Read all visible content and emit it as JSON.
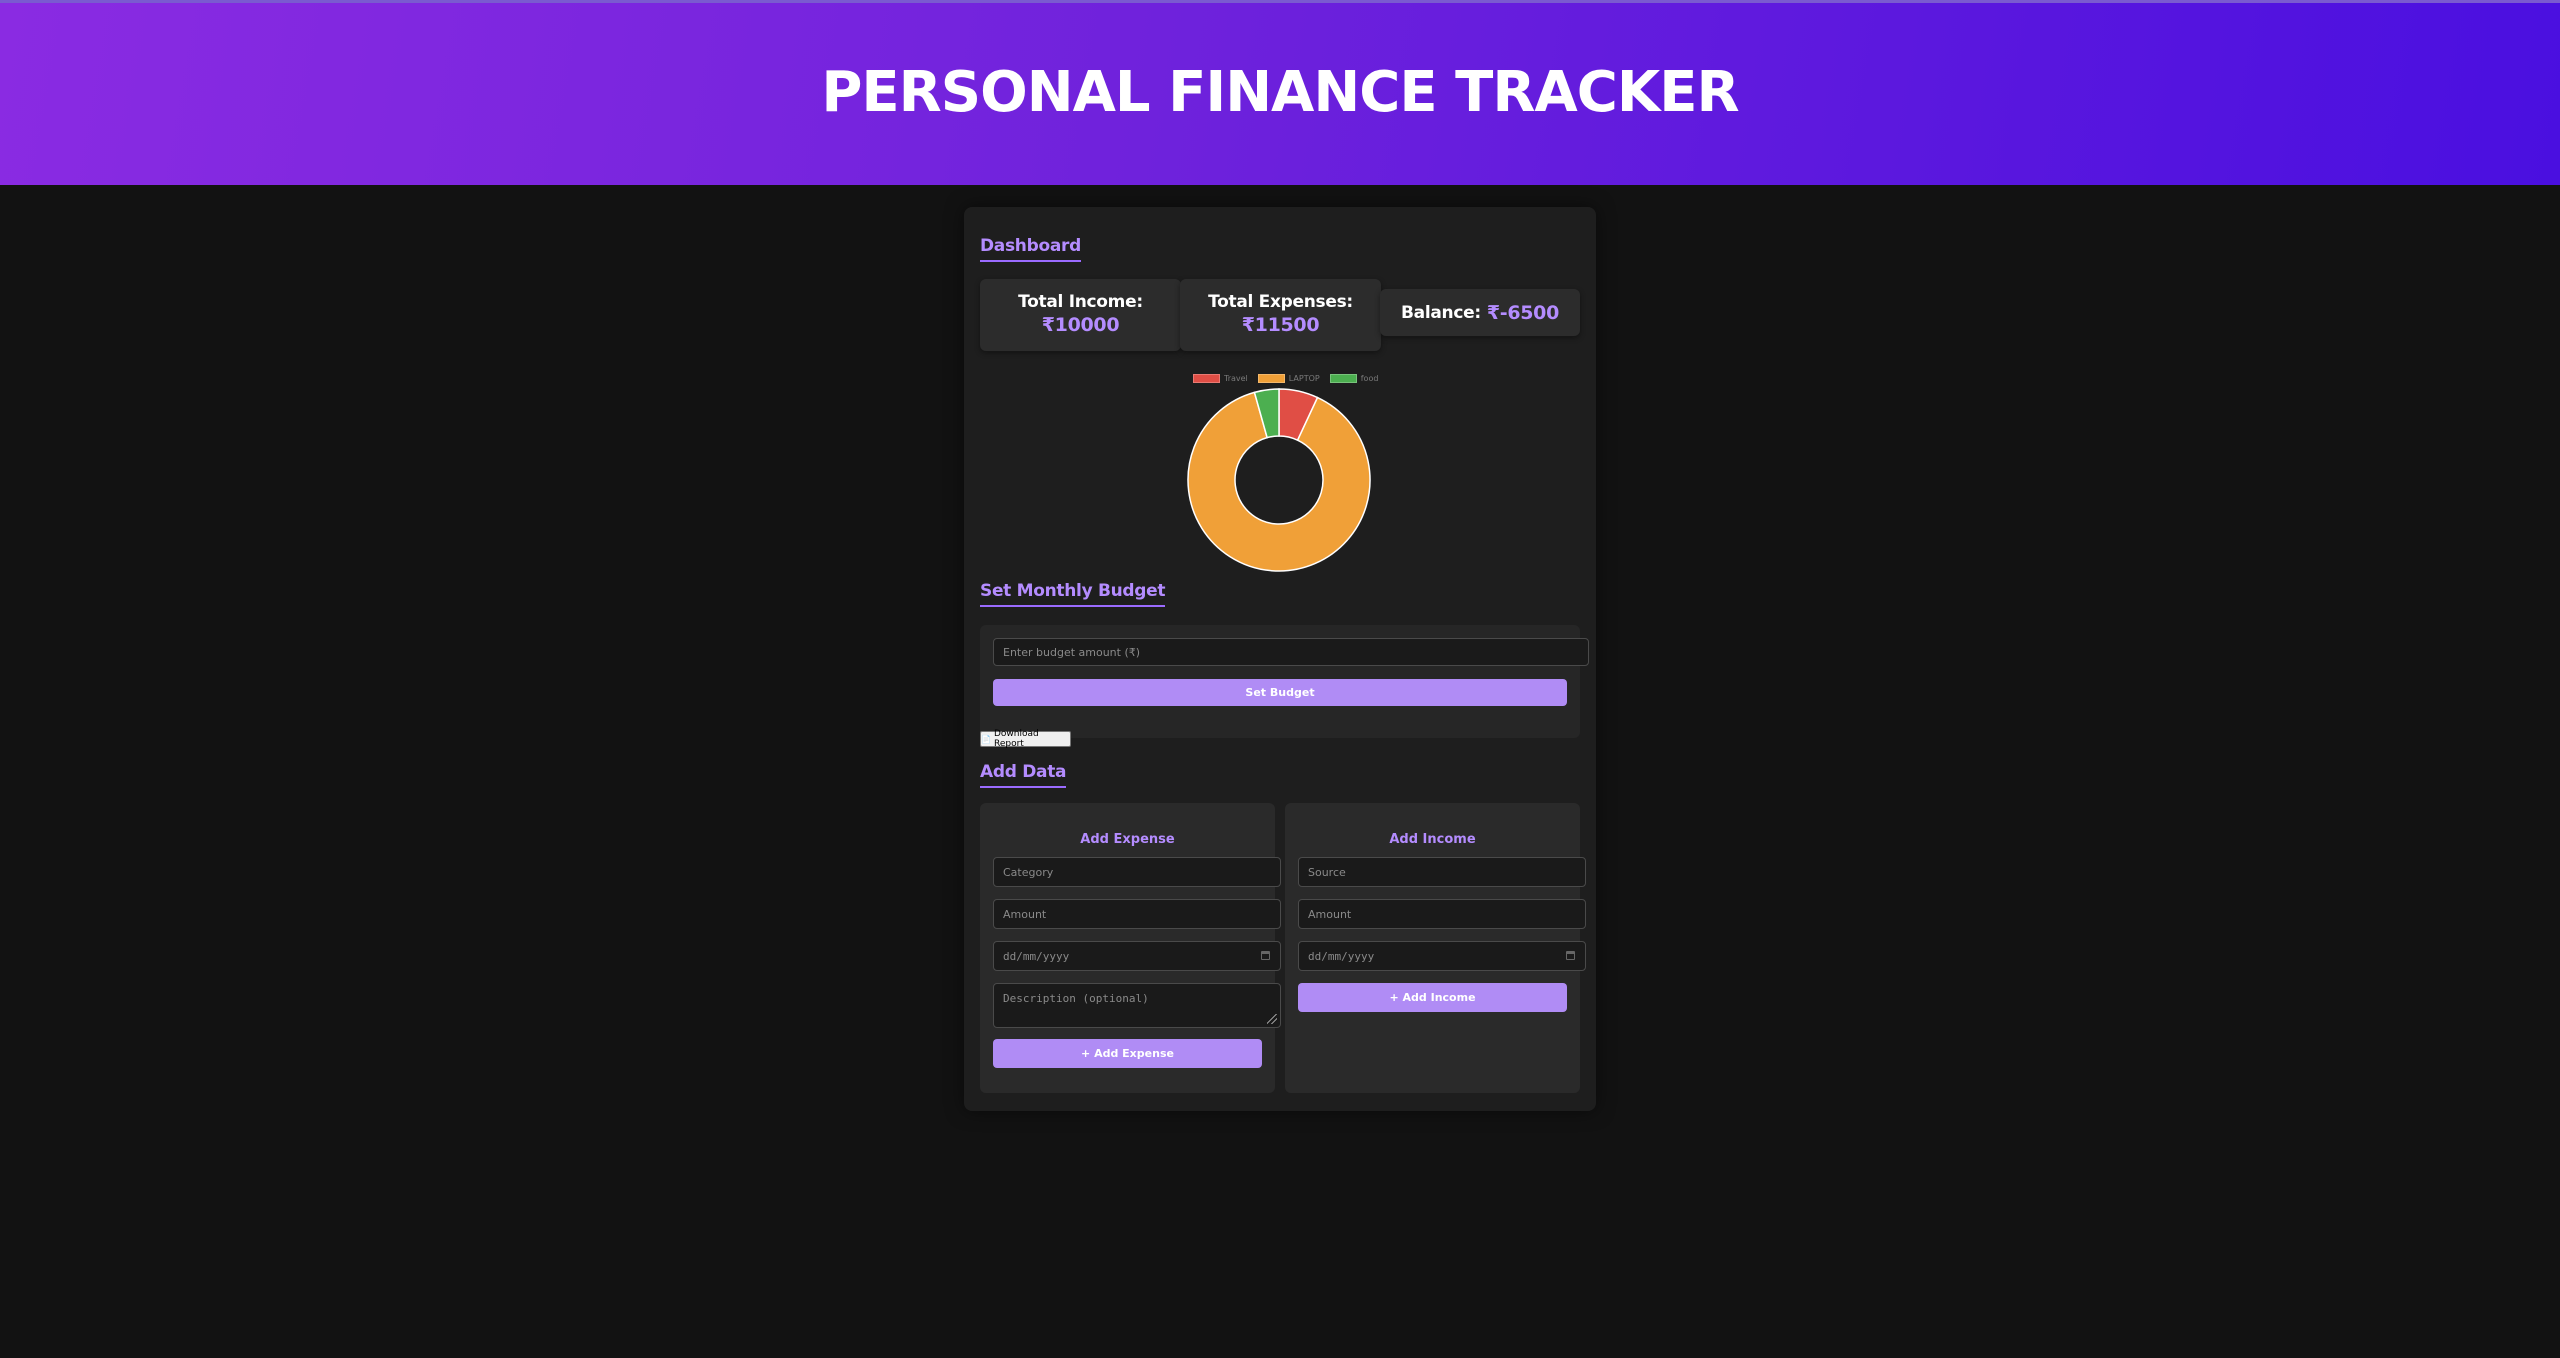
{
  "header": {
    "title": "PERSONAL FINANCE TRACKER"
  },
  "dashboard": {
    "title": "Dashboard",
    "income_label": "Total Income:",
    "income_value": "₹10000",
    "expenses_label": "Total Expenses:",
    "expenses_value": "₹11500",
    "balance_label": "Balance:",
    "balance_value": "₹-6500"
  },
  "chart_data": {
    "type": "pie",
    "labels": [
      "Travel",
      "LAPTOP",
      "food"
    ],
    "values": [
      800,
      10200,
      500
    ],
    "colors": [
      "#e04e45",
      "#f0a038",
      "#4caf50"
    ],
    "legend_position": "top"
  },
  "budget": {
    "title": "Set Monthly Budget",
    "input_placeholder": "Enter budget amount (₹)",
    "button_label": "Set Budget"
  },
  "report": {
    "button_label": "Download Report",
    "icon": "document-icon"
  },
  "add_data": {
    "title": "Add Data",
    "expense": {
      "title": "Add Expense",
      "category_placeholder": "Category",
      "amount_placeholder": "Amount",
      "date_placeholder": "dd/mm/yyyy",
      "description_placeholder": "Description (optional)",
      "button_label": "+ Add Expense"
    },
    "income": {
      "title": "Add Income",
      "source_placeholder": "Source",
      "amount_placeholder": "Amount",
      "date_placeholder": "dd/mm/yyyy",
      "button_label": "+ Add Income"
    }
  },
  "colors": {
    "accent": "#b08cf5",
    "header_start": "#8a2be2",
    "header_end": "#4a0fe0",
    "background": "#121212"
  }
}
